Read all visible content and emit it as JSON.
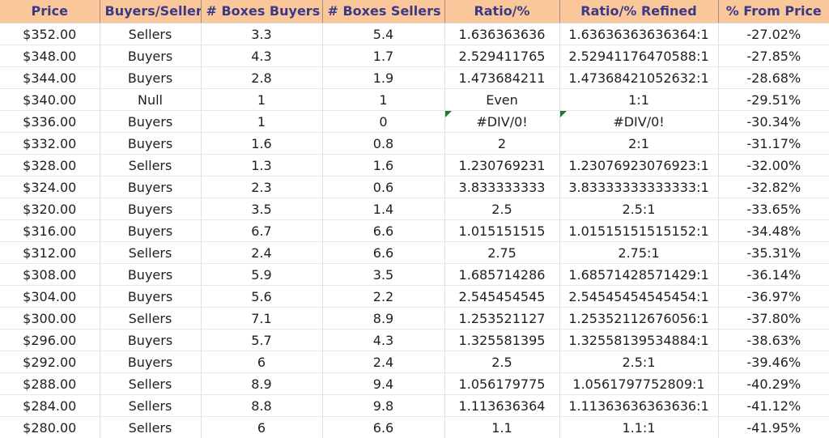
{
  "table": {
    "columns": [
      {
        "key": "price",
        "label": "Price"
      },
      {
        "key": "signal",
        "label": "Buyers/Sellers"
      },
      {
        "key": "boxes_buy",
        "label": "# Boxes Buyers"
      },
      {
        "key": "boxes_sell",
        "label": "# Boxes Sellers"
      },
      {
        "key": "ratio",
        "label": "Ratio/%"
      },
      {
        "key": "ratio_ref",
        "label": "Ratio/% Refined"
      },
      {
        "key": "pct",
        "label": "% From Price"
      }
    ],
    "colors": {
      "header_bg": "#f9c79a",
      "header_text": "#3a3a87",
      "buyers_bg": "#c6ebcf",
      "buyers_text": "#1e6b23",
      "sellers_bg": "#fac9ce",
      "sellers_text": "#cc2b45",
      "null_bg": "#fde699",
      "null_text": "#b8860b",
      "error_flag": "#1a7a33",
      "cell_text": "#1f1f1f",
      "grid_line": "#e0e0e0"
    },
    "rows": [
      {
        "price": "$352.00",
        "signal": "Sellers",
        "signal_kind": "sellers",
        "boxes_buy": "3.3",
        "boxes_sell": "5.4",
        "ratio": "1.636363636",
        "ratio_ref": "1.63636363636364:1",
        "pct": "-27.02%",
        "error": false
      },
      {
        "price": "$348.00",
        "signal": "Buyers",
        "signal_kind": "buyers",
        "boxes_buy": "4.3",
        "boxes_sell": "1.7",
        "ratio": "2.529411765",
        "ratio_ref": "2.52941176470588:1",
        "pct": "-27.85%",
        "error": false
      },
      {
        "price": "$344.00",
        "signal": "Buyers",
        "signal_kind": "buyers",
        "boxes_buy": "2.8",
        "boxes_sell": "1.9",
        "ratio": "1.473684211",
        "ratio_ref": "1.47368421052632:1",
        "pct": "-28.68%",
        "error": false
      },
      {
        "price": "$340.00",
        "signal": "Null",
        "signal_kind": "null",
        "boxes_buy": "1",
        "boxes_sell": "1",
        "ratio": "Even",
        "ratio_ref": "1:1",
        "pct": "-29.51%",
        "error": false
      },
      {
        "price": "$336.00",
        "signal": "Buyers",
        "signal_kind": "buyers",
        "boxes_buy": "1",
        "boxes_sell": "0",
        "ratio": "#DIV/0!",
        "ratio_ref": "#DIV/0!",
        "pct": "-30.34%",
        "error": true
      },
      {
        "price": "$332.00",
        "signal": "Buyers",
        "signal_kind": "buyers",
        "boxes_buy": "1.6",
        "boxes_sell": "0.8",
        "ratio": "2",
        "ratio_ref": "2:1",
        "pct": "-31.17%",
        "error": false
      },
      {
        "price": "$328.00",
        "signal": "Sellers",
        "signal_kind": "sellers",
        "boxes_buy": "1.3",
        "boxes_sell": "1.6",
        "ratio": "1.230769231",
        "ratio_ref": "1.23076923076923:1",
        "pct": "-32.00%",
        "error": false
      },
      {
        "price": "$324.00",
        "signal": "Buyers",
        "signal_kind": "buyers",
        "boxes_buy": "2.3",
        "boxes_sell": "0.6",
        "ratio": "3.833333333",
        "ratio_ref": "3.83333333333333:1",
        "pct": "-32.82%",
        "error": false
      },
      {
        "price": "$320.00",
        "signal": "Buyers",
        "signal_kind": "buyers",
        "boxes_buy": "3.5",
        "boxes_sell": "1.4",
        "ratio": "2.5",
        "ratio_ref": "2.5:1",
        "pct": "-33.65%",
        "error": false
      },
      {
        "price": "$316.00",
        "signal": "Buyers",
        "signal_kind": "buyers",
        "boxes_buy": "6.7",
        "boxes_sell": "6.6",
        "ratio": "1.015151515",
        "ratio_ref": "1.01515151515152:1",
        "pct": "-34.48%",
        "error": false
      },
      {
        "price": "$312.00",
        "signal": "Sellers",
        "signal_kind": "sellers",
        "boxes_buy": "2.4",
        "boxes_sell": "6.6",
        "ratio": "2.75",
        "ratio_ref": "2.75:1",
        "pct": "-35.31%",
        "error": false
      },
      {
        "price": "$308.00",
        "signal": "Buyers",
        "signal_kind": "buyers",
        "boxes_buy": "5.9",
        "boxes_sell": "3.5",
        "ratio": "1.685714286",
        "ratio_ref": "1.68571428571429:1",
        "pct": "-36.14%",
        "error": false
      },
      {
        "price": "$304.00",
        "signal": "Buyers",
        "signal_kind": "buyers",
        "boxes_buy": "5.6",
        "boxes_sell": "2.2",
        "ratio": "2.545454545",
        "ratio_ref": "2.54545454545454:1",
        "pct": "-36.97%",
        "error": false
      },
      {
        "price": "$300.00",
        "signal": "Sellers",
        "signal_kind": "sellers",
        "boxes_buy": "7.1",
        "boxes_sell": "8.9",
        "ratio": "1.253521127",
        "ratio_ref": "1.25352112676056:1",
        "pct": "-37.80%",
        "error": false
      },
      {
        "price": "$296.00",
        "signal": "Buyers",
        "signal_kind": "buyers",
        "boxes_buy": "5.7",
        "boxes_sell": "4.3",
        "ratio": "1.325581395",
        "ratio_ref": "1.32558139534884:1",
        "pct": "-38.63%",
        "error": false
      },
      {
        "price": "$292.00",
        "signal": "Buyers",
        "signal_kind": "buyers",
        "boxes_buy": "6",
        "boxes_sell": "2.4",
        "ratio": "2.5",
        "ratio_ref": "2.5:1",
        "pct": "-39.46%",
        "error": false
      },
      {
        "price": "$288.00",
        "signal": "Sellers",
        "signal_kind": "sellers",
        "boxes_buy": "8.9",
        "boxes_sell": "9.4",
        "ratio": "1.056179775",
        "ratio_ref": "1.0561797752809:1",
        "pct": "-40.29%",
        "error": false
      },
      {
        "price": "$284.00",
        "signal": "Sellers",
        "signal_kind": "sellers",
        "boxes_buy": "8.8",
        "boxes_sell": "9.8",
        "ratio": "1.113636364",
        "ratio_ref": "1.11363636363636:1",
        "pct": "-41.12%",
        "error": false
      },
      {
        "price": "$280.00",
        "signal": "Sellers",
        "signal_kind": "sellers",
        "boxes_buy": "6",
        "boxes_sell": "6.6",
        "ratio": "1.1",
        "ratio_ref": "1.1:1",
        "pct": "-41.95%",
        "error": false
      }
    ]
  }
}
